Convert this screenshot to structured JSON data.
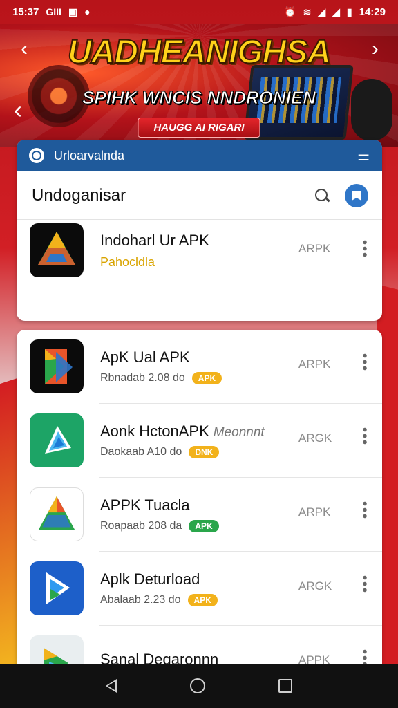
{
  "status_bar": {
    "time": "15:37",
    "left_glyph": "GIII",
    "clock_right": "14:29"
  },
  "banner": {
    "title": "UADHEANIGHSA",
    "subtitle": "SPIHK WNCIS NNDRONIEN",
    "pill": "HAUGG AI RIGARI"
  },
  "card1": {
    "bar_label": "Urloarvalnda",
    "search_query": "Undoganisar",
    "row": {
      "name": "Indoharl Ur APK",
      "sub": "Pahocldla",
      "type": "ARPK"
    }
  },
  "apps": [
    {
      "name": "ApK Ual APK",
      "name_extra": "",
      "sub": "Rbnadab 2.08 do",
      "badge": "APK",
      "badge_color": "#f2b21b",
      "type": "ARPK",
      "icon": "play-triangle-icon-dark"
    },
    {
      "name": "Aonk HctonAPK",
      "name_extra": "Meonnnt",
      "sub": "Daokaab A10 do",
      "badge": "DNK",
      "badge_color": "#f2b21b",
      "type": "ARGK",
      "icon": "play-triangle-icon-green"
    },
    {
      "name": "APPK Tuacla",
      "name_extra": "",
      "sub": "Roapaab 208 da",
      "badge": "APK",
      "badge_color": "#2aa64b",
      "type": "ARPK",
      "icon": "play-triangle-icon-white"
    },
    {
      "name": "Aplk Deturload",
      "name_extra": "",
      "sub": "Abalaab 2.23 do",
      "badge": "APK",
      "badge_color": "#f2b21b",
      "type": "ARGK",
      "icon": "play-triangle-icon-blue"
    },
    {
      "name": "Sanal Degaronnn",
      "name_extra": "",
      "sub": "",
      "badge": "",
      "badge_color": "#f2b21b",
      "type": "APPK",
      "icon": "play-triangle-icon-light"
    }
  ],
  "colors": {
    "header_blue": "#1f5a9b",
    "accent_red": "#d21f25",
    "badge_yellow": "#f2b21b",
    "badge_green": "#2aa64b"
  }
}
